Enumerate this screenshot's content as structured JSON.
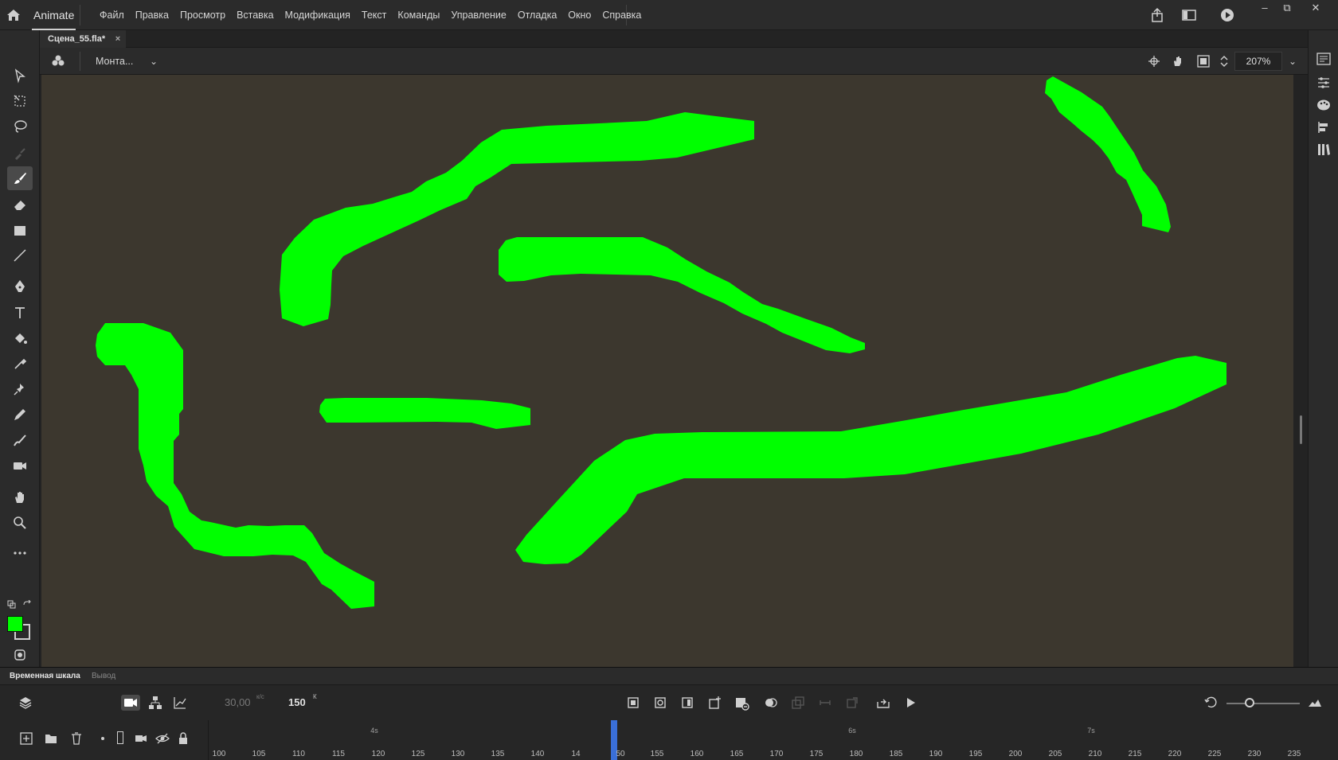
{
  "app": {
    "name": "Animate"
  },
  "menu": [
    "Файл",
    "Правка",
    "Просмотр",
    "Вставка",
    "Модификация",
    "Текст",
    "Команды",
    "Управление",
    "Отладка",
    "Окно",
    "Справка"
  ],
  "document": {
    "tab_title": "Сцена_55.fla*",
    "close_glyph": "×"
  },
  "stagebar": {
    "scene_select": "Монта...",
    "zoom": "207%"
  },
  "window_controls": {
    "minimize": "–",
    "restore": "⧉",
    "close": "✕"
  },
  "colors": {
    "fill": "#00ff00",
    "stage_bg": "#3c372e"
  },
  "timeline": {
    "tabs": [
      "Временная шкала",
      "Вывод"
    ],
    "fps": "30,00",
    "fps_unit": "к/с",
    "current_frame": "150",
    "frame_unit": "К",
    "ruler_ticks": [
      "100",
      "105",
      "110",
      "115",
      "120",
      "125",
      "130",
      "135",
      "140",
      "14",
      "50",
      "155",
      "160",
      "165",
      "170",
      "175",
      "180",
      "185",
      "190",
      "195",
      "200",
      "205",
      "210",
      "215",
      "220",
      "225",
      "230",
      "235"
    ],
    "second_markers": [
      "4s",
      "6s",
      "7s"
    ]
  },
  "tools": [
    "selection-tool",
    "subselection-tool",
    "lasso-tool",
    "brush-tool-disabled",
    "paint-brush-tool",
    "eraser-tool",
    "rectangle-tool",
    "line-tool",
    "pen-tool",
    "text-tool",
    "paint-bucket-tool",
    "eyedropper-tool",
    "pin-tool",
    "pencil-tool",
    "fluid-brush-tool",
    "camera-tool",
    "hand-tool",
    "zoom-tool",
    "more-tools"
  ]
}
